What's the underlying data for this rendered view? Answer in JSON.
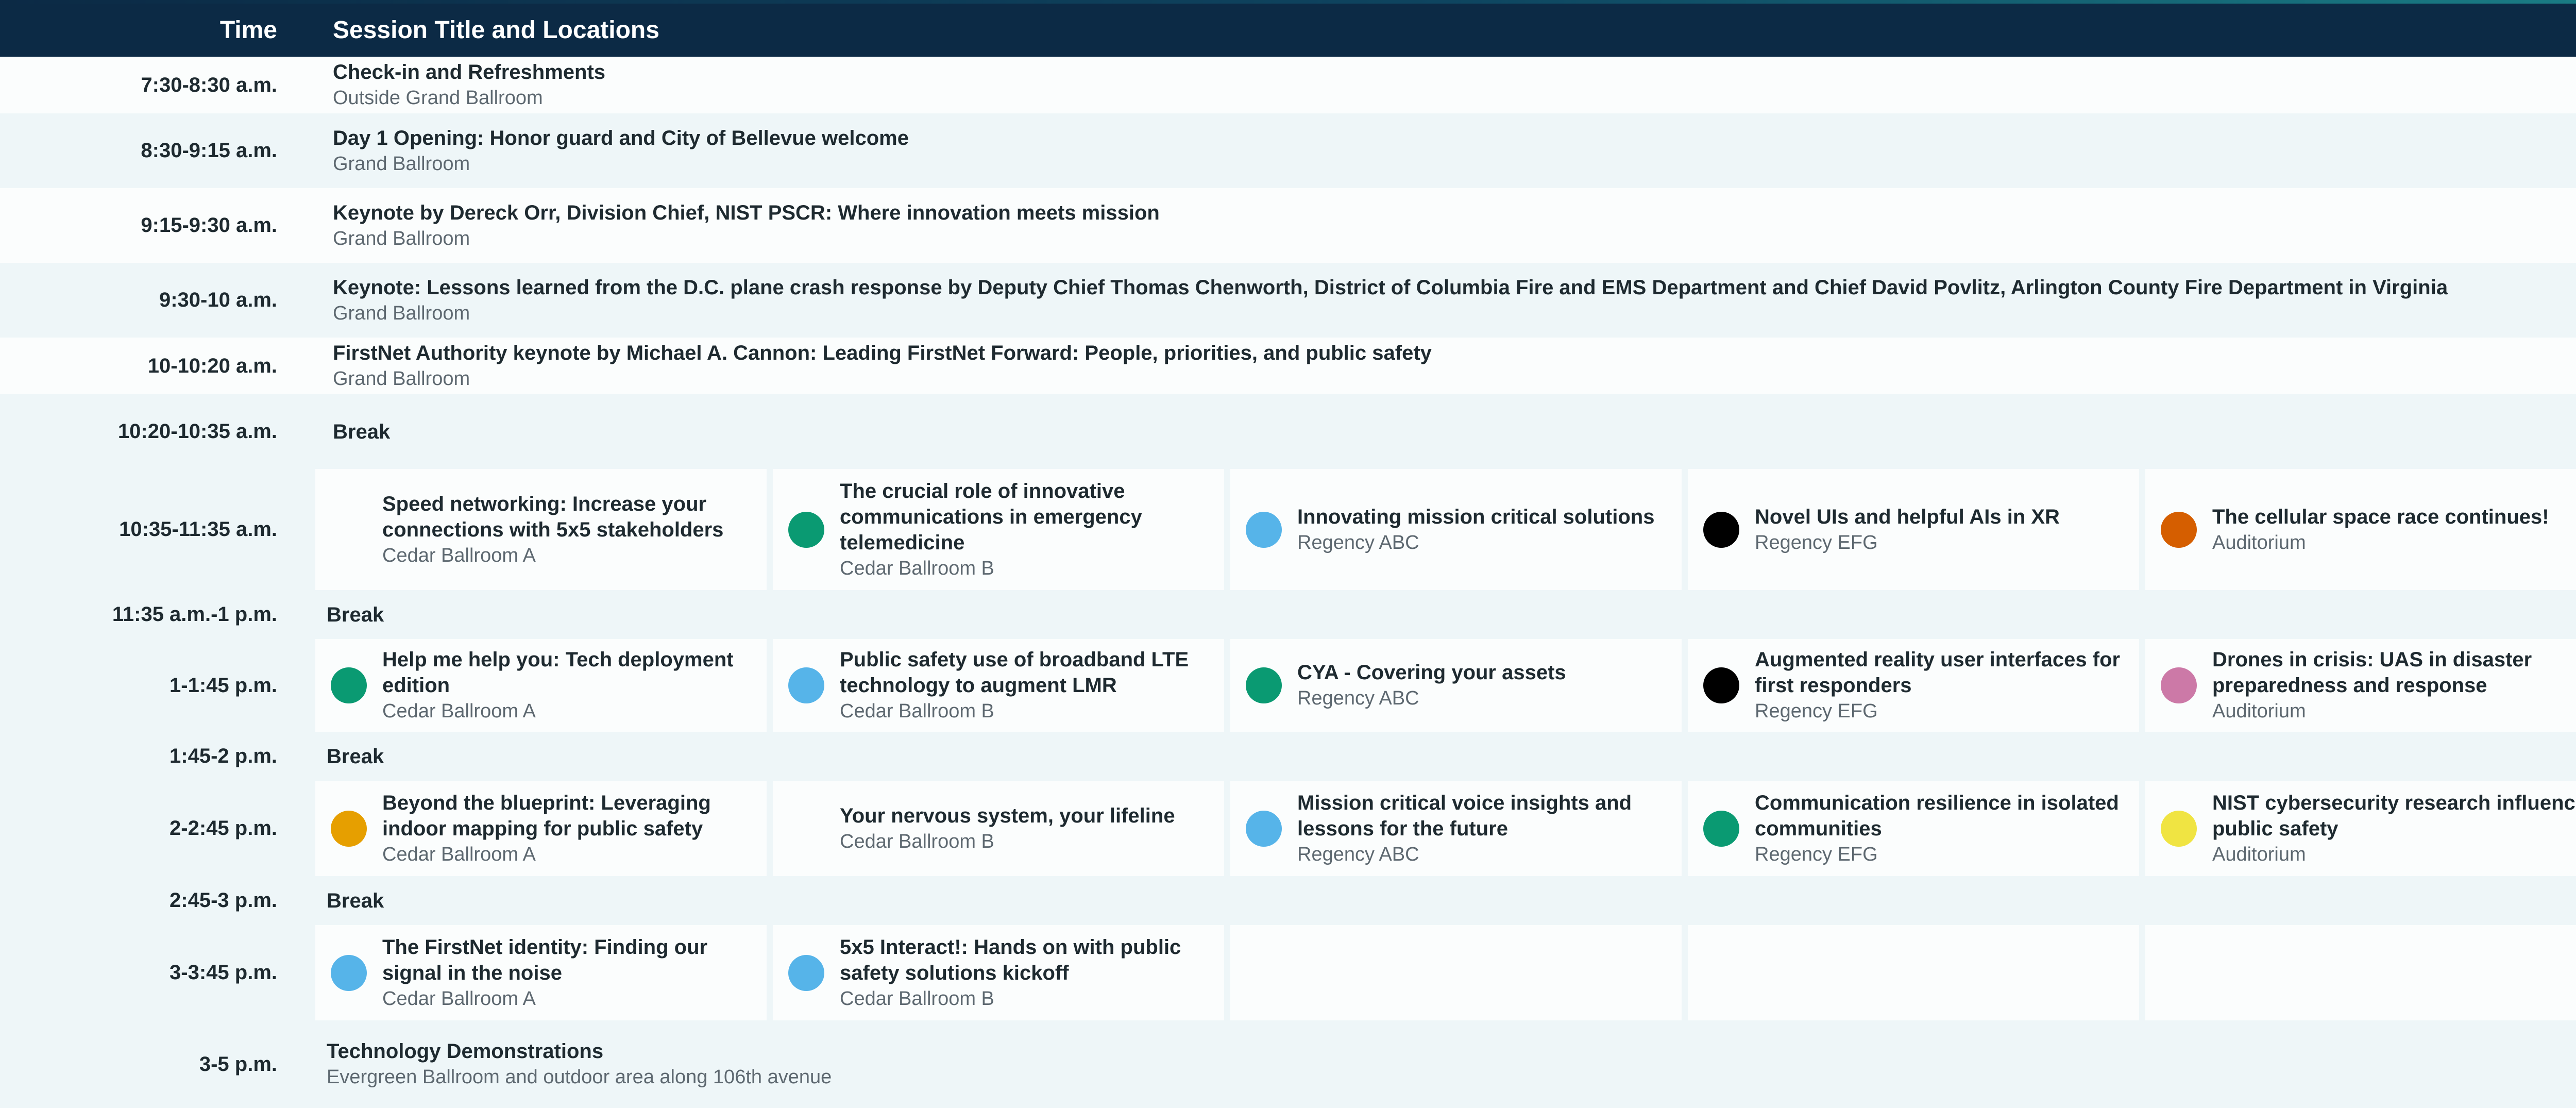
{
  "header": {
    "time_label": "Time",
    "session_label": "Session Title and Locations"
  },
  "colors": {
    "header_bg": "#0c2a45",
    "green": "#0a9a72",
    "light_blue": "#56b4e9",
    "black": "#000000",
    "orange": "#d55e00",
    "pink": "#cc79a7",
    "amber": "#e69f00",
    "yellow": "#f0e442"
  },
  "rows": [
    {
      "time": "7:30-8:30 a.m.",
      "title": "Check-in and Refreshments",
      "location": "Outside Grand Ballroom"
    },
    {
      "time": "8:30-9:15 a.m.",
      "title": "Day 1 Opening: Honor guard and City of Bellevue welcome",
      "location": "Grand Ballroom"
    },
    {
      "time": "9:15-9:30 a.m.",
      "title": "Keynote by Dereck Orr, Division Chief, NIST PSCR: Where innovation meets mission",
      "location": "Grand Ballroom"
    },
    {
      "time": "9:30-10 a.m.",
      "title": "Keynote: Lessons learned from the D.C. plane crash response by Deputy Chief Thomas Chenworth, District of Columbia Fire and EMS Department and Chief David Povlitz, Arlington County Fire Department in Virginia",
      "location": "Grand Ballroom"
    },
    {
      "time": "10-10:20 a.m.",
      "title": "FirstNet Authority keynote by Michael A. Cannon: Leading FirstNet Forward: People, priorities, and public safety",
      "location": "Grand Ballroom"
    },
    {
      "time": "10:20-10:35 a.m.",
      "title": "Break"
    },
    {
      "time": "10:35-11:35 a.m.",
      "tracks": [
        {
          "title": "Speed networking: Increase your connections with 5x5 stakeholders",
          "location": "Cedar Ballroom A",
          "dot": "none"
        },
        {
          "title": "The crucial role of innovative communications in emergency telemedicine",
          "location": "Cedar Ballroom B",
          "dot": "green"
        },
        {
          "title": "Innovating mission critical solutions",
          "location": "Regency ABC",
          "dot": "light-blue"
        },
        {
          "title": "Novel UIs and helpful AIs in XR",
          "location": "Regency EFG",
          "dot": "black"
        },
        {
          "title": "The cellular space race continues!",
          "location": "Auditorium",
          "dot": "orange"
        }
      ]
    },
    {
      "time": "11:35 a.m.-1 p.m.",
      "title": "Break"
    },
    {
      "time": "1-1:45 p.m.",
      "tracks": [
        {
          "title": "Help me help you: Tech deployment edition",
          "location": "Cedar Ballroom A",
          "dot": "green"
        },
        {
          "title": "Public safety use of broadband LTE technology to augment LMR",
          "location": "Cedar Ballroom B",
          "dot": "light-blue"
        },
        {
          "title": "CYA - Covering your assets",
          "location": "Regency ABC",
          "dot": "green"
        },
        {
          "title": "Augmented reality user interfaces for first responders",
          "location": "Regency EFG",
          "dot": "black"
        },
        {
          "title": "Drones in crisis: UAS in disaster preparedness and response",
          "location": "Auditorium",
          "dot": "pink"
        }
      ]
    },
    {
      "time": "1:45-2 p.m.",
      "title": "Break"
    },
    {
      "time": "2-2:45 p.m.",
      "tracks": [
        {
          "title": "Beyond the blueprint: Leveraging indoor mapping for public safety",
          "location": "Cedar Ballroom A",
          "dot": "amber"
        },
        {
          "title": "Your nervous system, your lifeline",
          "location": "Cedar Ballroom B",
          "dot": "none"
        },
        {
          "title": "Mission critical voice insights and lessons for the future",
          "location": "Regency ABC",
          "dot": "light-blue"
        },
        {
          "title": "Communication resilience in isolated communities",
          "location": "Regency EFG",
          "dot": "green"
        },
        {
          "title": "NIST cybersecurity research influences on public safety",
          "location": "Auditorium",
          "dot": "yellow"
        }
      ]
    },
    {
      "time": "2:45-3 p.m.",
      "title": "Break"
    },
    {
      "time": "3-3:45 p.m.",
      "tracks": [
        {
          "title": "The FirstNet identity: Finding our signal in the noise",
          "location": "Cedar Ballroom A",
          "dot": "light-blue"
        },
        {
          "title": "5x5 Interact!: Hands on with public safety solutions kickoff",
          "location": "Cedar Ballroom B",
          "dot": "light-blue"
        },
        {
          "title": "",
          "location": "",
          "dot": "none"
        },
        {
          "title": "",
          "location": "",
          "dot": "none"
        },
        {
          "title": "",
          "location": "",
          "dot": "none"
        }
      ]
    },
    {
      "time": "3-5 p.m.",
      "title": "Technology Demonstrations",
      "location": "Evergreen Ballroom and outdoor area along 106th avenue"
    }
  ]
}
